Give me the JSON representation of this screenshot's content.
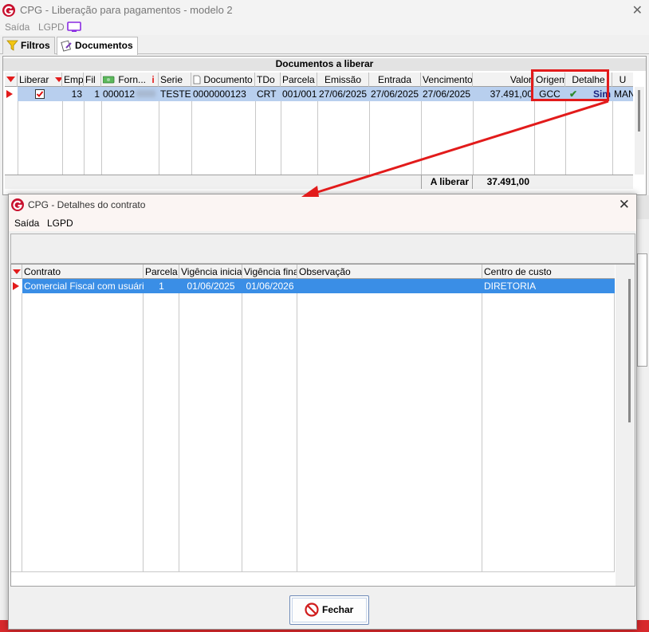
{
  "main_window": {
    "title": "CPG - Liberação para pagamentos - modelo 2",
    "close": "✕",
    "menu": [
      "Saída",
      "LGPD"
    ],
    "tabs": [
      "Filtros",
      "Documentos"
    ]
  },
  "documents_grid": {
    "caption": "Documentos a liberar",
    "columns": [
      "Liberar",
      "Emp",
      "Fil",
      "Forn...",
      "Serie",
      "Documento",
      "TDo",
      "Parcela",
      "Emissão",
      "Entrada",
      "Vencimento",
      "Valor",
      "Origem",
      "Detalhe",
      "U"
    ],
    "row": {
      "emp": "13",
      "fil": "1",
      "forn": "000012",
      "serie": "TESTE",
      "documento": "0000000123",
      "tdo": "CRT",
      "parcela": "001/001",
      "emissao": "27/06/2025",
      "entrada": "27/06/2025",
      "vencimento": "27/06/2025",
      "valor": "37.491,00",
      "origem": "GCC",
      "detalhe": "Sim",
      "u": "MAN"
    },
    "footer_label": "A liberar",
    "footer_total": "37.491,00"
  },
  "dialog": {
    "title": "CPG - Detalhes do contrato",
    "close": "✕",
    "menu": [
      "Saída",
      "LGPD"
    ],
    "columns": [
      "Contrato",
      "Parcela",
      "Vigência inicial",
      "Vigência final",
      "Observação",
      "Centro de custo"
    ],
    "row": {
      "contrato": "Comercial Fiscal com usuário ...",
      "parcela": "1",
      "vigencia_inicial": "01/06/2025",
      "vigencia_final": "01/06/2026",
      "observacao": "",
      "centro_custo": "DIRETORIA"
    },
    "close_button": "Fechar"
  },
  "colors": {
    "selection_main": "#b8cfee",
    "selection_dialog": "#3a8ee6",
    "highlight_red": "#e21b1b"
  },
  "icons": [
    "app-logo-icon",
    "monitor-icon",
    "filter-icon",
    "documents-icon",
    "supplier-money-icon",
    "sort-info-icon",
    "close-icon",
    "fechar-stop-icon"
  ]
}
